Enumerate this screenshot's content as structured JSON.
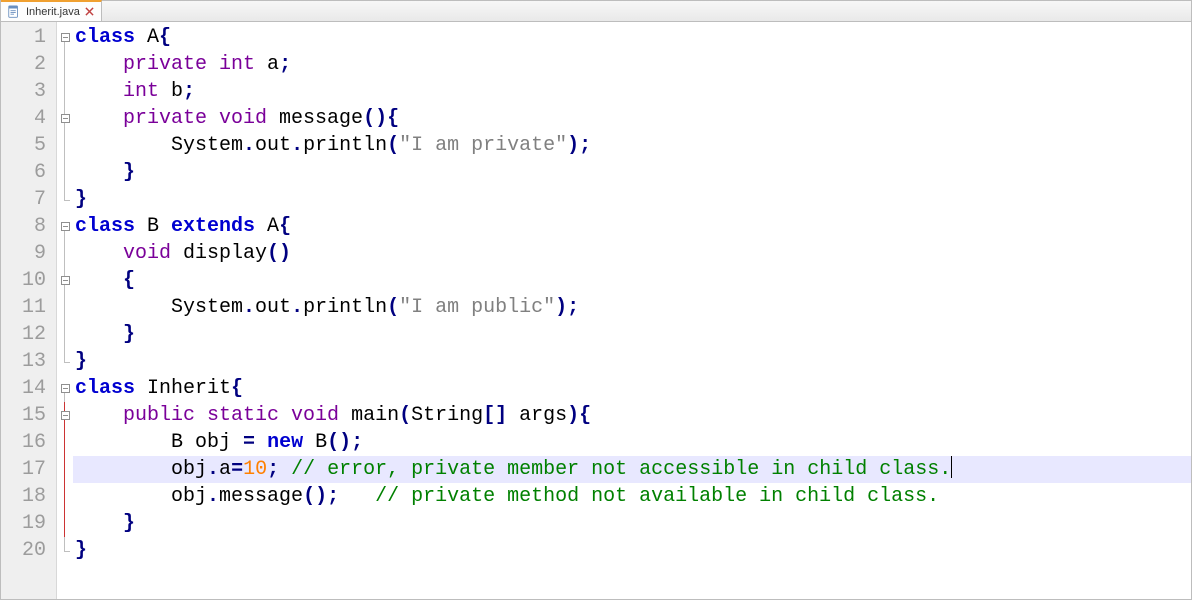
{
  "tab": {
    "filename": "Inherit.java"
  },
  "editor": {
    "current_line": 17,
    "line_numbers": [
      "1",
      "2",
      "3",
      "4",
      "5",
      "6",
      "7",
      "8",
      "9",
      "10",
      "11",
      "12",
      "13",
      "14",
      "15",
      "16",
      "17",
      "18",
      "19",
      "20"
    ],
    "folds": {
      "1": {
        "box": true,
        "lineBelow": true
      },
      "2": {
        "lineAbove": true,
        "lineBelow": true
      },
      "3": {
        "lineAbove": true,
        "lineBelow": true
      },
      "4": {
        "box": true,
        "lineAbove": true,
        "lineBelow": true
      },
      "5": {
        "lineAbove": true,
        "lineBelow": true
      },
      "6": {
        "lineAbove": true,
        "lineBelow": true
      },
      "7": {
        "lineAbove": true,
        "corner": true
      },
      "8": {
        "box": true,
        "lineBelow": true
      },
      "9": {
        "lineAbove": true,
        "lineBelow": true
      },
      "10": {
        "box": true,
        "lineAbove": true,
        "lineBelow": true
      },
      "11": {
        "lineAbove": true,
        "lineBelow": true
      },
      "12": {
        "lineAbove": true,
        "lineBelow": true
      },
      "13": {
        "lineAbove": true,
        "corner": true
      },
      "14": {
        "box": true,
        "lineBelow": true
      },
      "15": {
        "box": true,
        "lineAbove": true,
        "lineBelow": true,
        "red": true
      },
      "16": {
        "lineAbove": true,
        "lineBelow": true,
        "red": true
      },
      "17": {
        "lineAbove": true,
        "lineBelow": true,
        "red": true
      },
      "18": {
        "lineAbove": true,
        "lineBelow": true,
        "red": true
      },
      "19": {
        "lineAbove": true,
        "lineBelow": true,
        "red": true
      },
      "20": {
        "lineAbove": true,
        "corner": true
      }
    },
    "code": [
      [
        {
          "t": "class ",
          "c": "kw"
        },
        {
          "t": "A",
          "c": "ident"
        },
        {
          "t": "{",
          "c": "punct"
        }
      ],
      [
        {
          "t": "    ",
          "c": "plain"
        },
        {
          "t": "private ",
          "c": "mod"
        },
        {
          "t": "int ",
          "c": "type"
        },
        {
          "t": "a",
          "c": "ident"
        },
        {
          "t": ";",
          "c": "punct"
        }
      ],
      [
        {
          "t": "    ",
          "c": "plain"
        },
        {
          "t": "int ",
          "c": "type"
        },
        {
          "t": "b",
          "c": "ident"
        },
        {
          "t": ";",
          "c": "punct"
        }
      ],
      [
        {
          "t": "    ",
          "c": "plain"
        },
        {
          "t": "private ",
          "c": "mod"
        },
        {
          "t": "void ",
          "c": "type"
        },
        {
          "t": "message",
          "c": "ident"
        },
        {
          "t": "(){",
          "c": "punct"
        }
      ],
      [
        {
          "t": "        System",
          "c": "ident"
        },
        {
          "t": ".",
          "c": "punct"
        },
        {
          "t": "out",
          "c": "ident"
        },
        {
          "t": ".",
          "c": "punct"
        },
        {
          "t": "println",
          "c": "ident"
        },
        {
          "t": "(",
          "c": "punct"
        },
        {
          "t": "\"I am private\"",
          "c": "str"
        },
        {
          "t": ");",
          "c": "punct"
        }
      ],
      [
        {
          "t": "    ",
          "c": "plain"
        },
        {
          "t": "}",
          "c": "punct"
        }
      ],
      [
        {
          "t": "}",
          "c": "punct"
        }
      ],
      [
        {
          "t": "class ",
          "c": "kw"
        },
        {
          "t": "B ",
          "c": "ident"
        },
        {
          "t": "extends ",
          "c": "kw"
        },
        {
          "t": "A",
          "c": "ident"
        },
        {
          "t": "{",
          "c": "punct"
        }
      ],
      [
        {
          "t": "    ",
          "c": "plain"
        },
        {
          "t": "void ",
          "c": "type"
        },
        {
          "t": "display",
          "c": "ident"
        },
        {
          "t": "()",
          "c": "punct"
        }
      ],
      [
        {
          "t": "    ",
          "c": "plain"
        },
        {
          "t": "{",
          "c": "punct"
        }
      ],
      [
        {
          "t": "        System",
          "c": "ident"
        },
        {
          "t": ".",
          "c": "punct"
        },
        {
          "t": "out",
          "c": "ident"
        },
        {
          "t": ".",
          "c": "punct"
        },
        {
          "t": "println",
          "c": "ident"
        },
        {
          "t": "(",
          "c": "punct"
        },
        {
          "t": "\"I am public\"",
          "c": "str"
        },
        {
          "t": ");",
          "c": "punct"
        }
      ],
      [
        {
          "t": "    ",
          "c": "plain"
        },
        {
          "t": "}",
          "c": "punct"
        }
      ],
      [
        {
          "t": "}",
          "c": "punct"
        }
      ],
      [
        {
          "t": "class ",
          "c": "kw"
        },
        {
          "t": "Inherit",
          "c": "ident"
        },
        {
          "t": "{",
          "c": "punct"
        }
      ],
      [
        {
          "t": "    ",
          "c": "plain"
        },
        {
          "t": "public ",
          "c": "mod"
        },
        {
          "t": "static ",
          "c": "mod"
        },
        {
          "t": "void ",
          "c": "type"
        },
        {
          "t": "main",
          "c": "ident"
        },
        {
          "t": "(",
          "c": "punct"
        },
        {
          "t": "String",
          "c": "ident"
        },
        {
          "t": "[]",
          "c": "punct"
        },
        {
          "t": " args",
          "c": "ident"
        },
        {
          "t": "){",
          "c": "punct"
        }
      ],
      [
        {
          "t": "        B obj ",
          "c": "ident"
        },
        {
          "t": "=",
          "c": "punct"
        },
        {
          "t": " ",
          "c": "plain"
        },
        {
          "t": "new ",
          "c": "kw"
        },
        {
          "t": "B",
          "c": "ident"
        },
        {
          "t": "();",
          "c": "punct"
        }
      ],
      [
        {
          "t": "        obj",
          "c": "ident"
        },
        {
          "t": ".",
          "c": "punct"
        },
        {
          "t": "a",
          "c": "ident"
        },
        {
          "t": "=",
          "c": "punct"
        },
        {
          "t": "10",
          "c": "num"
        },
        {
          "t": ";",
          "c": "punct"
        },
        {
          "t": " ",
          "c": "plain"
        },
        {
          "t": "// error, private member not accessible in child class.",
          "c": "comm"
        }
      ],
      [
        {
          "t": "        obj",
          "c": "ident"
        },
        {
          "t": ".",
          "c": "punct"
        },
        {
          "t": "message",
          "c": "ident"
        },
        {
          "t": "();",
          "c": "punct"
        },
        {
          "t": "   ",
          "c": "plain"
        },
        {
          "t": "// private method not available in child class.",
          "c": "comm"
        }
      ],
      [
        {
          "t": "    ",
          "c": "plain"
        },
        {
          "t": "}",
          "c": "punct"
        }
      ],
      [
        {
          "t": "}",
          "c": "punct"
        }
      ]
    ]
  }
}
